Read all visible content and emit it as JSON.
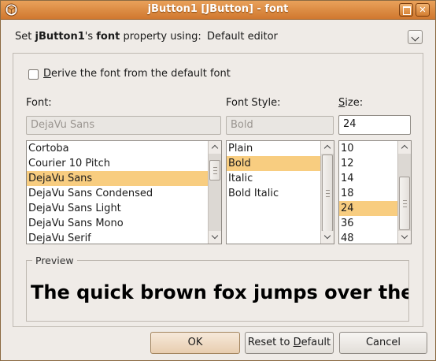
{
  "window": {
    "title": "jButton1 [JButton] - font"
  },
  "header": {
    "prefix": "Set ",
    "component": "jButton1",
    "middle": "'s ",
    "property": "font",
    "suffix": " property using:",
    "editor": "Default editor"
  },
  "derive": {
    "label_mnemonic": "D",
    "label_rest": "erive the font from the default font",
    "checked": false
  },
  "font": {
    "label": "Font:",
    "value": "DejaVu Sans",
    "items": [
      "Cortoba",
      "Courier 10 Pitch",
      "DejaVu Sans",
      "DejaVu Sans Condensed",
      "DejaVu Sans Light",
      "DejaVu Sans Mono",
      "DejaVu Serif"
    ],
    "selected_index": 2
  },
  "style": {
    "label": "Font Style:",
    "value": "Bold",
    "items": [
      "Plain",
      "Bold",
      "Italic",
      "Bold Italic"
    ],
    "selected_index": 1
  },
  "size": {
    "label": "Size:",
    "value": "24",
    "items": [
      "10",
      "12",
      "14",
      "18",
      "24",
      "36",
      "48"
    ],
    "selected_index": 4
  },
  "preview": {
    "legend": "Preview",
    "text": "The quick brown fox jumps over the lazy dog"
  },
  "buttons": {
    "ok": "OK",
    "reset_pre": "Reset to ",
    "reset_mnemonic": "D",
    "reset_post": "efault",
    "cancel": "Cancel"
  },
  "colors": {
    "titlebar": "#d98a3e",
    "selection": "#f8cd80",
    "background": "#efebe7"
  }
}
